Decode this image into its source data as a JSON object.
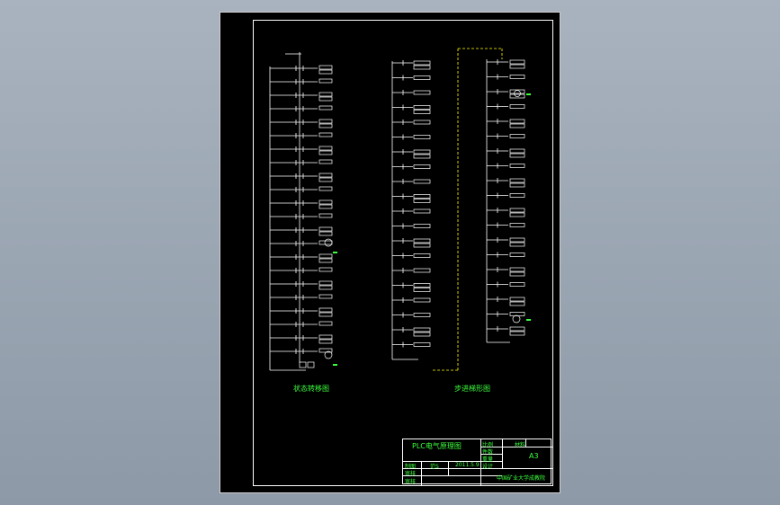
{
  "captions": {
    "state_diagram": "状态转移图",
    "sfc_diagram": "步进梯形图"
  },
  "title_block": {
    "drawing_title": "PLC电气原理图",
    "ratio_label": "比例",
    "material_label": "材料",
    "quantity_label": "件数",
    "weight_label": "重量",
    "sheet_size": "A3",
    "drawn_label": "制图",
    "drawn_by": "范S",
    "date": "2011.5.9",
    "design_label": "设计",
    "review_label": "审核",
    "school": "中国矿业大学成教院"
  },
  "colors": {
    "background_gradient_top": "#a9b3bf",
    "sheet": "#000000",
    "lines": "#ffffff",
    "text": "#3cff3c",
    "dashed_connector": "#ffff00"
  }
}
